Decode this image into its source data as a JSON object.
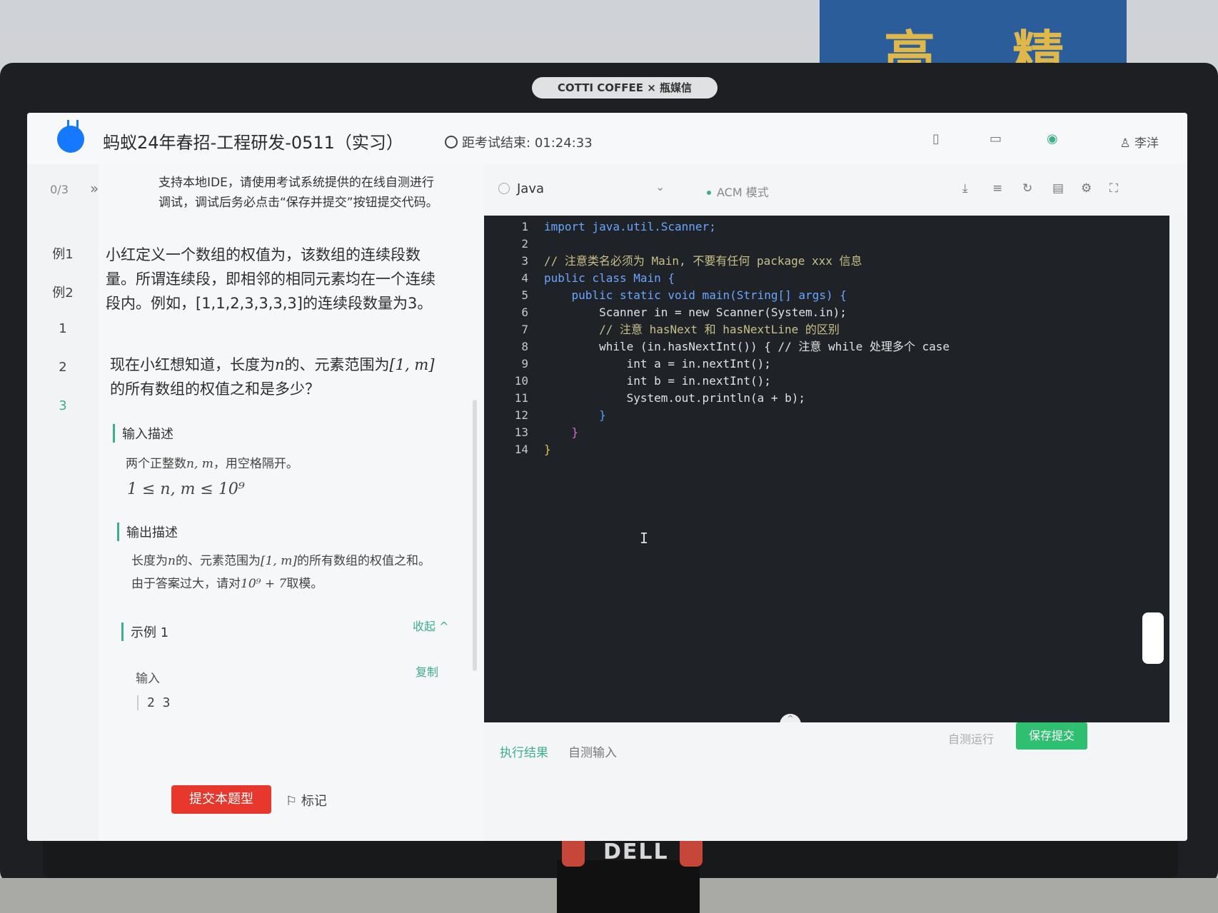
{
  "sticker": "COTTI COFFEE × 瓶媒信",
  "brand": "DELL",
  "header": {
    "exam_title": "蚂蚁24年春招-工程研发-0511（实习）",
    "timer_label": "距考试结束:",
    "timer_value": "01:24:33",
    "user_name": "李洋",
    "icons": [
      "phone-icon",
      "monitor-icon",
      "camera-icon",
      "user-icon"
    ]
  },
  "rail": {
    "progress": "0/3",
    "expand": "»",
    "items": [
      "例1",
      "例2",
      "1",
      "2",
      "3"
    ]
  },
  "problem": {
    "notice": "支持本地IDE，请使用考试系统提供的在线自测进行调试，调试后务必点击“保存并提交”按钮提交代码。",
    "para1": "小红定义一个数组的权值为，该数组的连续段数量。所谓连续段，即相邻的相同元素均在一个连续段内。例如，[1,1,2,3,3,3,3]的连续段数量为3。",
    "para2_a": "现在小红想知道，长度为",
    "para2_n": "n",
    "para2_b": "的、元素范围为",
    "para2_range": "[1, m]",
    "para2_c": "的所有数组的权值之和是多少？",
    "input_title": "输入描述",
    "input_desc_a": "两个正整数",
    "input_desc_vars": "n, m",
    "input_desc_b": "，用空格隔开。",
    "input_constraint": "1 ≤ n, m ≤ 10⁹",
    "output_title": "输出描述",
    "output_desc_a": "长度为",
    "output_desc_n": "n",
    "output_desc_b": "的、元素范围为",
    "output_desc_range": "[1, m]",
    "output_desc_c": "的所有数组的权值之和。由于答案过大，请对",
    "output_desc_mod": "10⁹ + 7",
    "output_desc_d": "取模。",
    "sample_title": "示例 1",
    "collapse": "收起 ^",
    "input_label": "输入",
    "copy": "复制",
    "sample_input": "2 3",
    "submit_button": "提交本题型",
    "mark_label": "标记"
  },
  "editor": {
    "language": "Java",
    "mode": "ACM 模式",
    "tools": [
      "download-icon",
      "format-icon",
      "refresh-icon",
      "template-icon",
      "settings-icon",
      "fullscreen-icon"
    ],
    "lines": [
      {
        "n": "1",
        "text": "import java.util.Scanner;"
      },
      {
        "n": "2",
        "text": ""
      },
      {
        "n": "3",
        "text": "// 注意类名必须为 Main, 不要有任何 package xxx 信息"
      },
      {
        "n": "4",
        "text": "public class Main {"
      },
      {
        "n": "5",
        "text": "    public static void main(String[] args) {"
      },
      {
        "n": "6",
        "text": "        Scanner in = new Scanner(System.in);"
      },
      {
        "n": "7",
        "text": "        // 注意 hasNext 和 hasNextLine 的区别"
      },
      {
        "n": "8",
        "text": "        while (in.hasNextInt()) { // 注意 while 处理多个 case"
      },
      {
        "n": "9",
        "text": "            int a = in.nextInt();"
      },
      {
        "n": "10",
        "text": "            int b = in.nextInt();"
      },
      {
        "n": "11",
        "text": "            System.out.println(a + b);"
      },
      {
        "n": "12",
        "text": "        }"
      },
      {
        "n": "13",
        "text": "    }"
      },
      {
        "n": "14",
        "text": "}"
      }
    ],
    "cursor": "I"
  },
  "bottom": {
    "tab_result": "执行结果",
    "tab_input": "自测输入",
    "run_label": "自测运行",
    "save_submit": "保存提交"
  },
  "colors": {
    "accent": "#3fae8b",
    "submit_red": "#e8382e",
    "save_green": "#2fbf71",
    "editor_bg": "#1f2227"
  }
}
